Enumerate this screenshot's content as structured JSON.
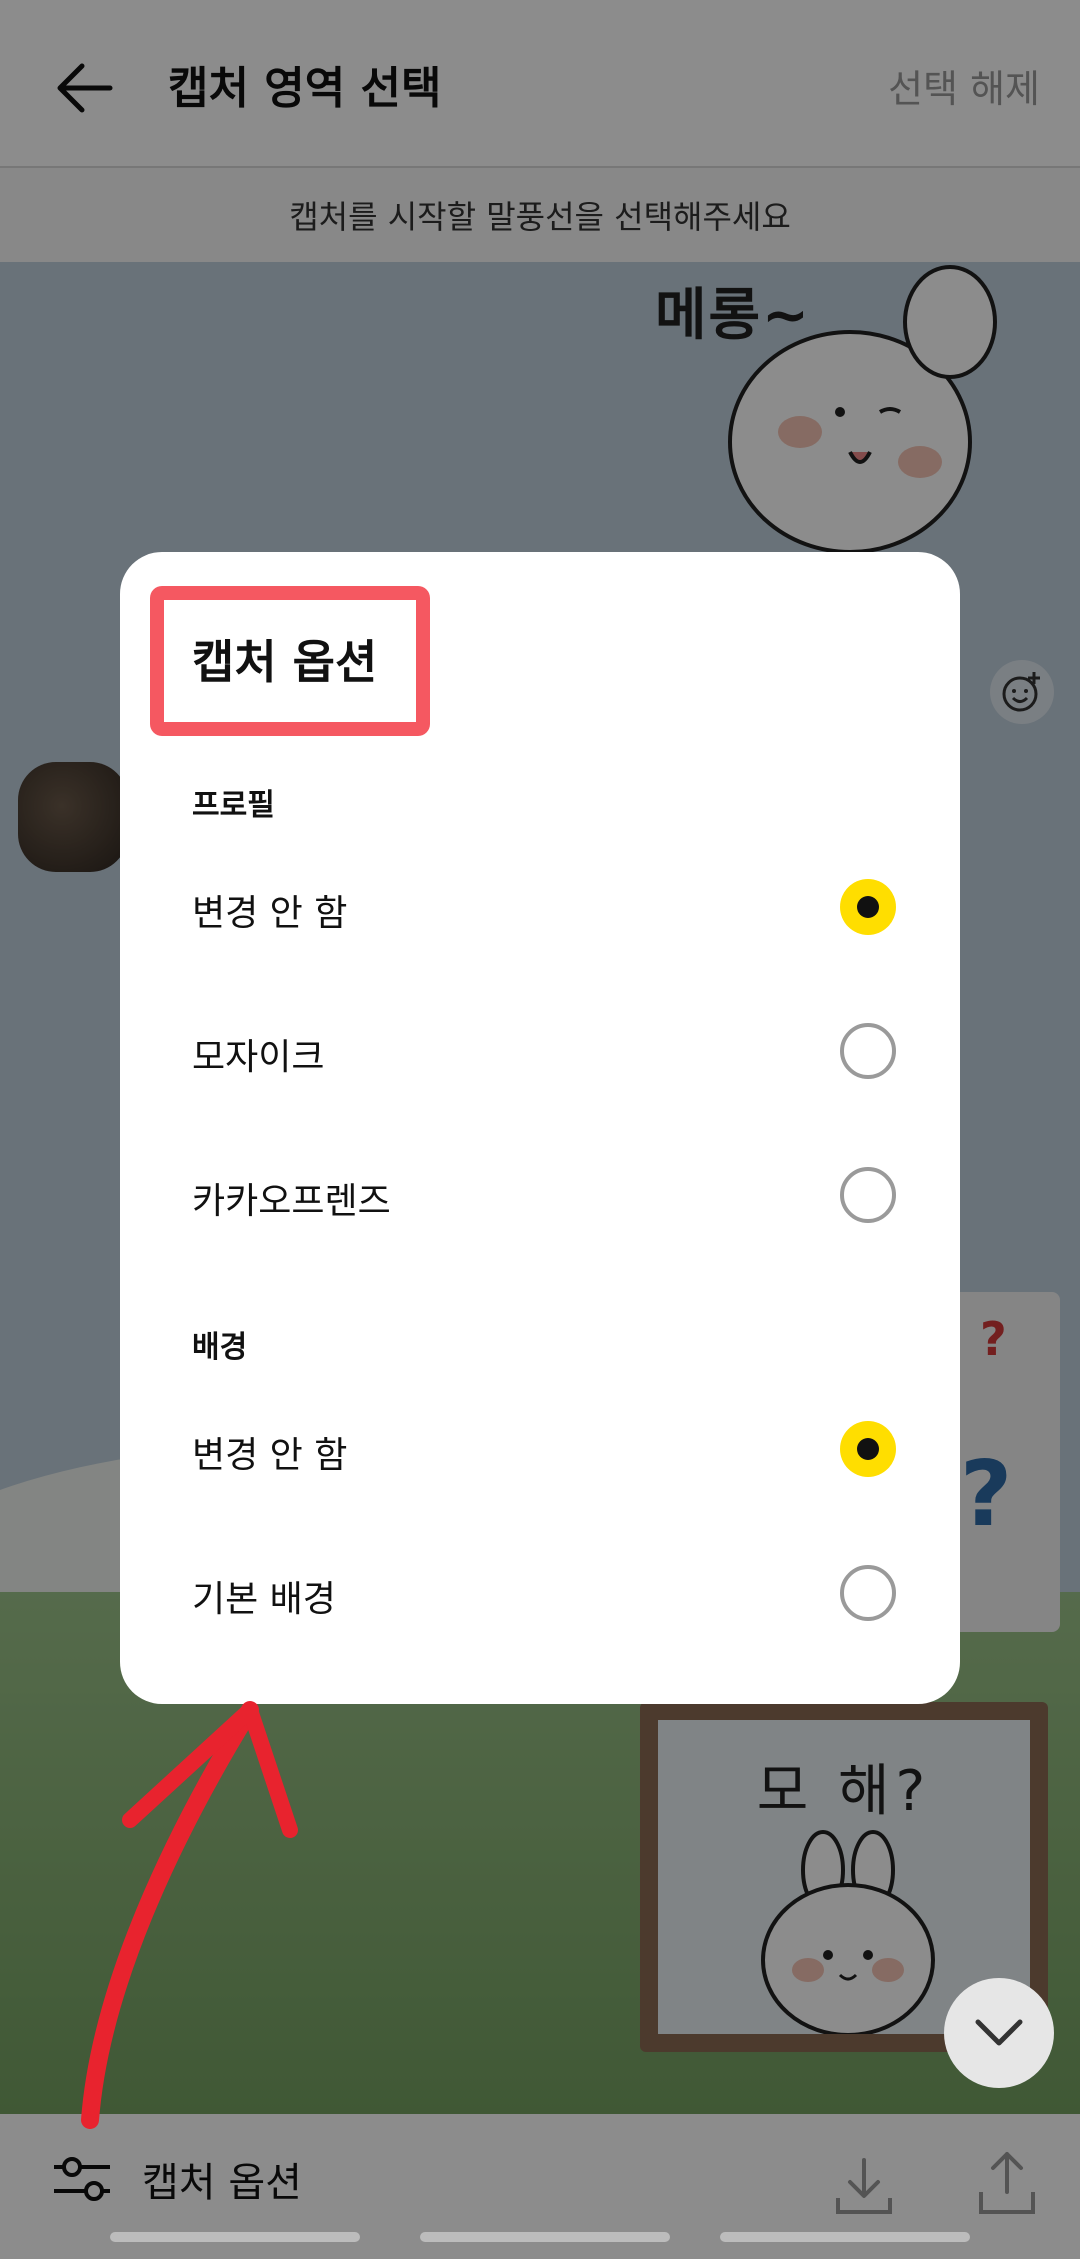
{
  "appbar": {
    "title": "캡처 영역 선택",
    "deselect_label": "선택 해제"
  },
  "hint": {
    "text": "캡처를 시작할 말풍선을 선택해주세요"
  },
  "chat": {
    "sticker_melong_text": "메롱~",
    "sticker_frame_text": "모 해?",
    "sticker_question_top": "?",
    "sticker_question_big": "?"
  },
  "dialog": {
    "title": "캡처 옵션",
    "sections": [
      {
        "title": "프로필",
        "options": [
          {
            "label": "변경 안 함",
            "selected": true
          },
          {
            "label": "모자이크",
            "selected": false
          },
          {
            "label": "카카오프렌즈",
            "selected": false
          }
        ]
      },
      {
        "title": "배경",
        "options": [
          {
            "label": "변경 안 함",
            "selected": true
          },
          {
            "label": "기본 배경",
            "selected": false
          }
        ]
      }
    ]
  },
  "bottombar": {
    "options_label": "캡처 옵션"
  },
  "colors": {
    "radio_selected": "#ffde00",
    "annotation": "#f44650"
  },
  "icons": {
    "back": "arrow-left-icon",
    "options": "sliders-icon",
    "download": "download-icon",
    "share": "share-icon",
    "scroll_down": "chevron-down-icon",
    "emoji_react": "emoji-add-icon"
  }
}
